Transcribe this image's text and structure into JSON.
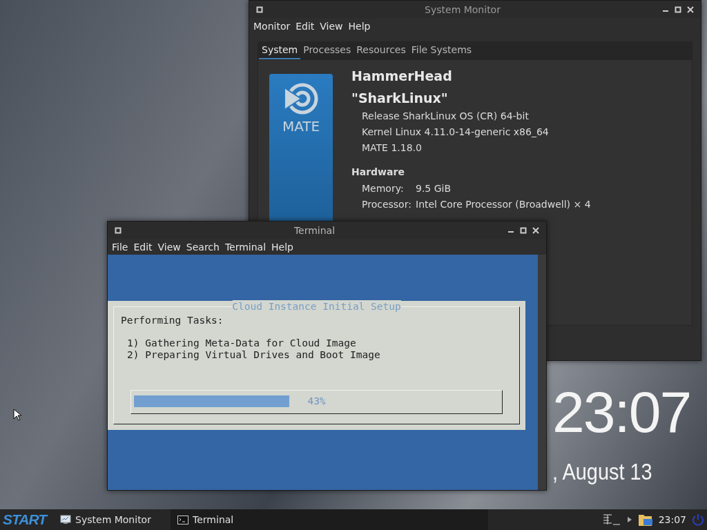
{
  "desktop": {
    "clock": "23:07",
    "date": ", August 13"
  },
  "system_monitor": {
    "title": "System Monitor",
    "menu": [
      "Monitor",
      "Edit",
      "View",
      "Help"
    ],
    "tabs": [
      {
        "label": "System",
        "selected": true
      },
      {
        "label": "Processes",
        "selected": false
      },
      {
        "label": "Resources",
        "selected": false
      },
      {
        "label": "File Systems",
        "selected": false
      }
    ],
    "logo_text": "MATE",
    "hostname": "HammerHead",
    "distro": "\"SharkLinux\"",
    "info": [
      "Release SharkLinux OS (CR) 64-bit",
      "Kernel Linux 4.11.0-14-generic x86_64",
      "MATE 1.18.0"
    ],
    "hardware_heading": "Hardware",
    "hardware": [
      {
        "label": "Memory:",
        "value": "9.5 GiB"
      },
      {
        "label": "Processor:",
        "value": "Intel Core Processor (Broadwell) × 4"
      }
    ]
  },
  "terminal": {
    "title": "Terminal",
    "menu": [
      "File",
      "Edit",
      "View",
      "Search",
      "Terminal",
      "Help"
    ],
    "dialog": {
      "title": "Cloud Instance Initial Setup",
      "heading": "Performing Tasks:",
      "tasks": [
        "1) Gathering Meta-Data for Cloud Image",
        "2) Preparing Virtual Drives and Boot Image"
      ],
      "progress": {
        "level": 0.43,
        "reading": "43%"
      }
    }
  },
  "taskbar": {
    "start": "START",
    "items": [
      {
        "label": "System Monitor",
        "kind": "monitor",
        "selected": false
      },
      {
        "label": "Terminal",
        "kind": "terminal",
        "selected": true
      }
    ],
    "time": "23:07"
  }
}
